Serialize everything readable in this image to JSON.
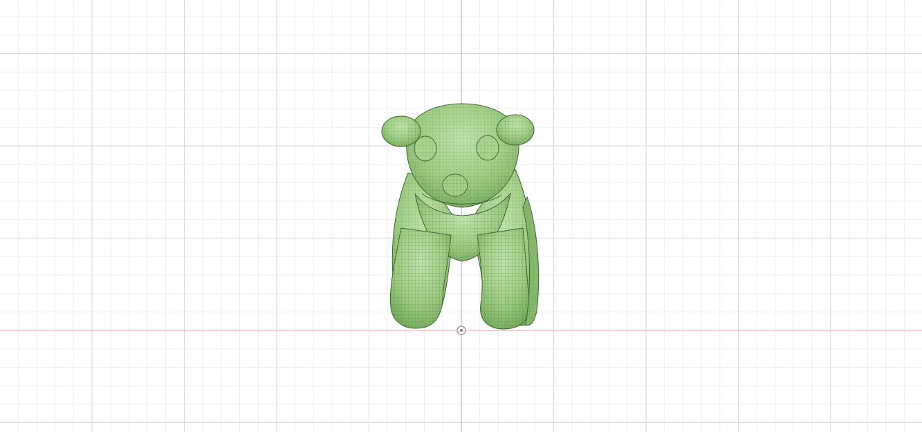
{
  "viewport": {
    "view": "front",
    "grid": true,
    "colors": {
      "background": "#ffffff",
      "grid_minor": "#eeeef2",
      "grid_major": "#d6d6de",
      "axis_vertical": "#a6a6d6",
      "axis_horizontal": "#ef9f9f",
      "model_fill": "#9ccc82",
      "model_mesh": "#4f7a3e",
      "origin_marker": "#8a8a8a"
    },
    "model": {
      "icon": "bear-mesh",
      "shading": "wireframe-on-shaded"
    },
    "origin": {
      "icon": "origin-pivot-icon"
    }
  }
}
